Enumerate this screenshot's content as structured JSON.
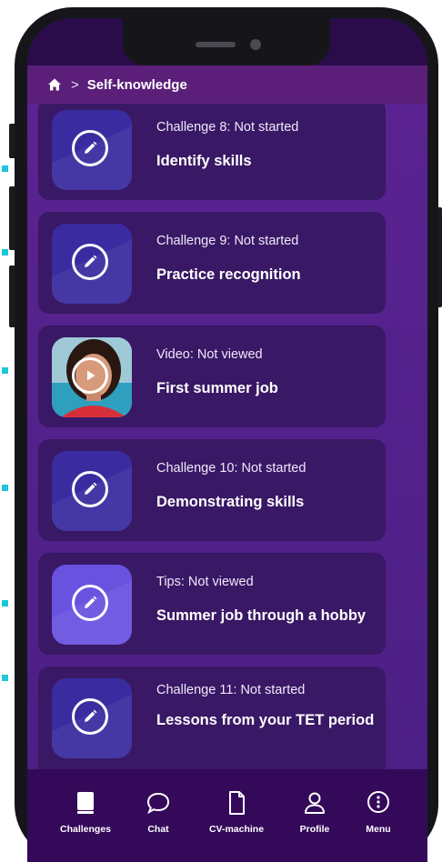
{
  "colors": {
    "accent_cyan": "#1ec6d8",
    "screen_purple": "#4a1d80",
    "card_purple": "#391865",
    "tabbar_purple": "#34095a"
  },
  "header": {
    "home_icon": "home-icon",
    "separator": ">",
    "breadcrumb": "Self-knowledge"
  },
  "items": [
    {
      "type": "challenge",
      "icon": "pencil-icon",
      "status": "Challenge 8: Not started",
      "title": "Identify skills"
    },
    {
      "type": "challenge",
      "icon": "pencil-icon",
      "status": "Challenge 9: Not started",
      "title": "Practice recognition"
    },
    {
      "type": "video",
      "icon": "play-icon",
      "status": "Video: Not viewed",
      "title": "First summer job"
    },
    {
      "type": "challenge",
      "icon": "pencil-icon",
      "status": "Challenge 10: Not started",
      "title": "Demonstrating skills"
    },
    {
      "type": "tips",
      "icon": "pencil-icon",
      "status": "Tips: Not viewed",
      "title": "Summer job through a hobby"
    },
    {
      "type": "challenge",
      "icon": "pencil-icon",
      "status": "Challenge 11: Not started",
      "title": "Lessons from your TET period"
    }
  ],
  "tabs": [
    {
      "label": "Challenges",
      "icon": "challenges-icon"
    },
    {
      "label": "Chat",
      "icon": "chat-icon"
    },
    {
      "label": "CV-machine",
      "icon": "document-icon"
    },
    {
      "label": "Profile",
      "icon": "profile-icon"
    },
    {
      "label": "Menu",
      "icon": "more-icon"
    }
  ]
}
